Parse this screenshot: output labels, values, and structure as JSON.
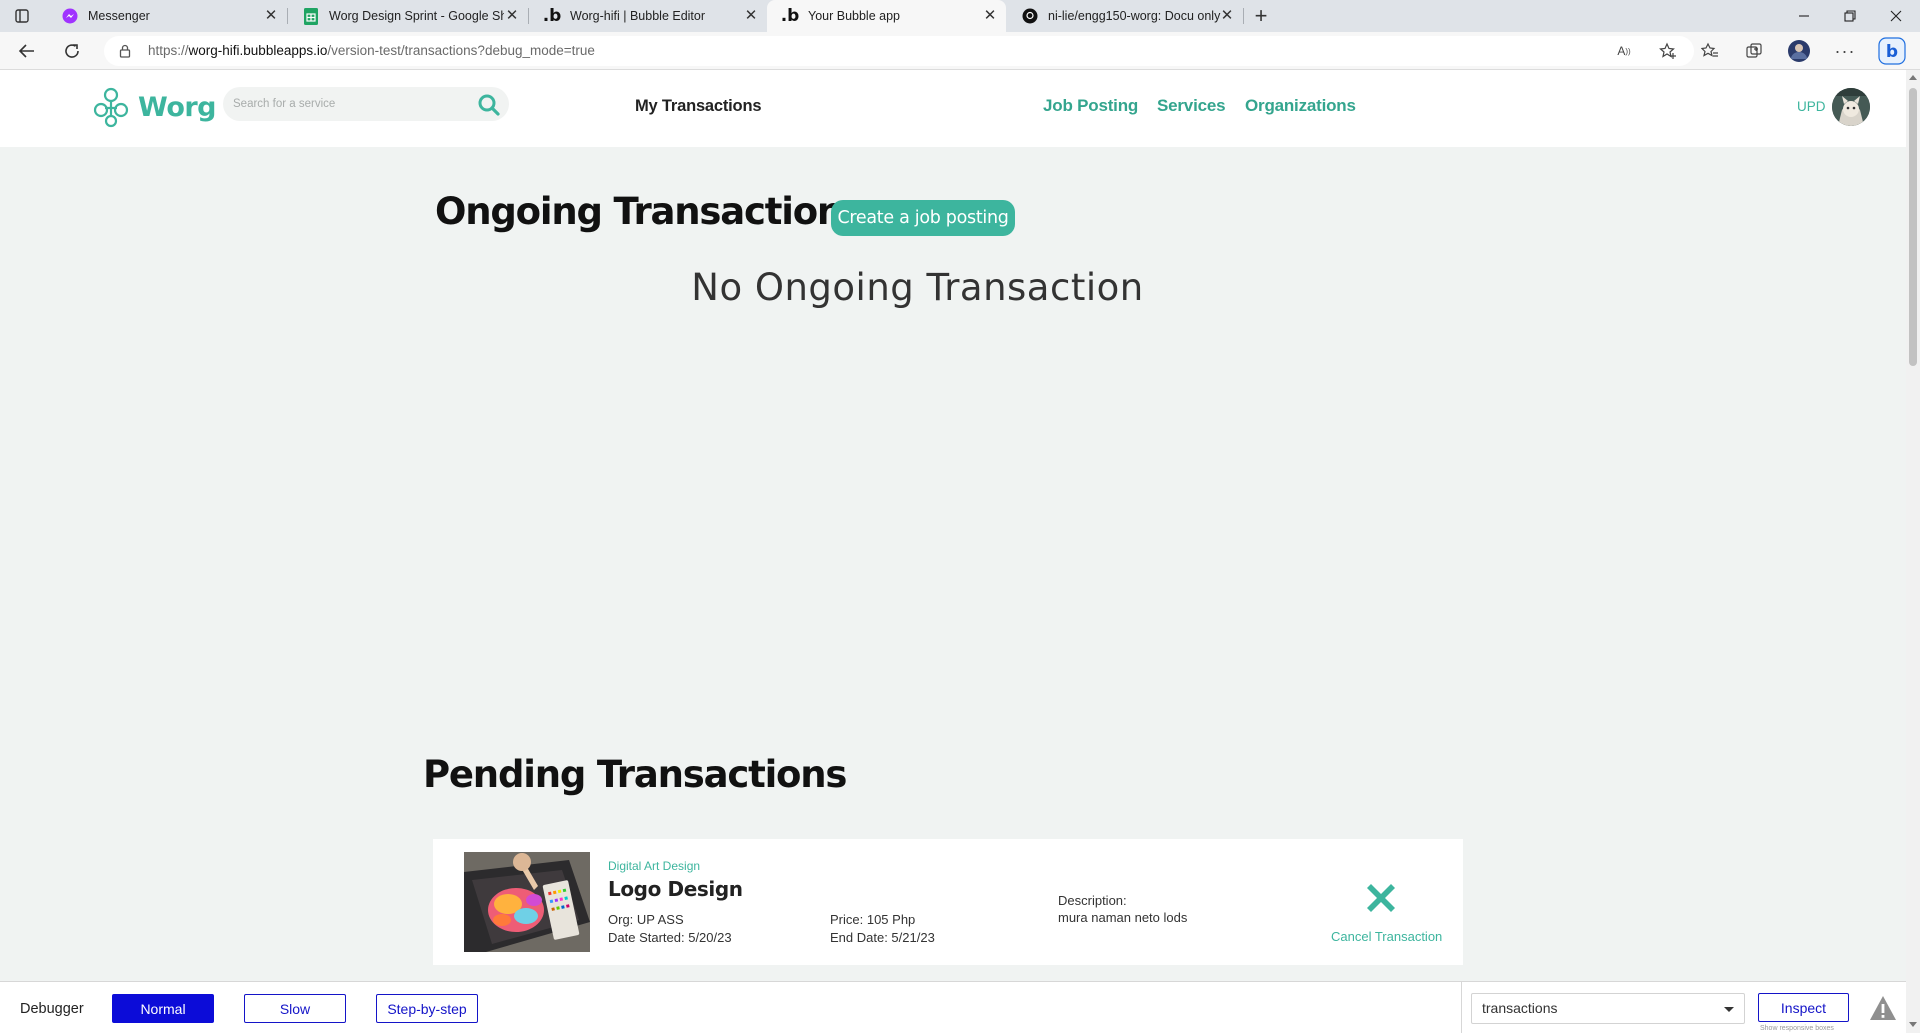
{
  "browser": {
    "tabs": [
      {
        "label": "Messenger",
        "icon": "messenger-icon"
      },
      {
        "label": "Worg Design Sprint - Google Sheets",
        "icon": "sheets-icon"
      },
      {
        "label": "Worg-hifi | Bubble Editor",
        "icon": "bubble-icon"
      },
      {
        "label": "Your Bubble app",
        "icon": "bubble-icon",
        "active": true
      },
      {
        "label": "ni-lie/engg150-worg: Docu only",
        "icon": "github-icon"
      }
    ],
    "url": {
      "scheme": "https://",
      "host": "worg-hifi.bubbleapps.io",
      "path": "/version-test/transactions?debug_mode=true"
    }
  },
  "header": {
    "logo_text": "Worg",
    "search_placeholder": "Search for a service",
    "search_value": "",
    "current_page": "My Transactions",
    "nav": [
      "Job Posting",
      "Services",
      "Organizations"
    ],
    "user_label": "UPD",
    "accent_color": "#3db59e"
  },
  "ongoing": {
    "title": "Ongoing Transactions",
    "cta_label": "Create a job posting",
    "empty_message": "No Ongoing Transaction"
  },
  "pending": {
    "title": "Pending Transactions",
    "items": [
      {
        "category": "Digital Art Design",
        "title": "Logo Design",
        "org": "Org: UP ASS",
        "date_started": "Date Started: 5/20/23",
        "price": "Price: 105 Php",
        "end_date": "End Date: 5/21/23",
        "description_label": "Description:",
        "description": "mura naman neto lods",
        "cancel_label": "Cancel Transaction"
      }
    ]
  },
  "debugger": {
    "label": "Debugger",
    "modes": [
      "Normal",
      "Slow",
      "Step-by-step"
    ],
    "active_mode": "Normal",
    "page_select": "transactions",
    "inspect_label": "Inspect",
    "responsive_label": "Show responsive boxes"
  }
}
